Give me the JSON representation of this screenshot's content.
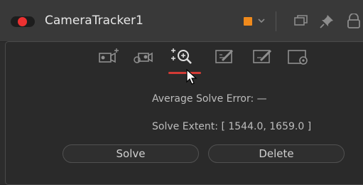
{
  "header": {
    "title": "CameraTracker1",
    "enable_toggle_color": "#ec3131",
    "tile_color": "#f08a1c",
    "icons": [
      "enable-toggle",
      "color-swatch",
      "chevron-down-icon",
      "versions-icon",
      "pin-icon",
      "lock-icon"
    ]
  },
  "mode_toolbar": {
    "icons": [
      "track-camera-icon",
      "solve-cameras-icon",
      "zoom-solve-icon",
      "edit-export-icon",
      "edit-export-alt-icon",
      "options-icon"
    ],
    "active_index": 2,
    "active_color": "#d33b35"
  },
  "info": {
    "average_solve_error_label": "Average Solve Error: —",
    "solve_extent_label": "Solve Extent:  [ 1544.0, 1659.0 ]"
  },
  "buttons": {
    "solve_label": "Solve",
    "delete_label": "Delete"
  }
}
